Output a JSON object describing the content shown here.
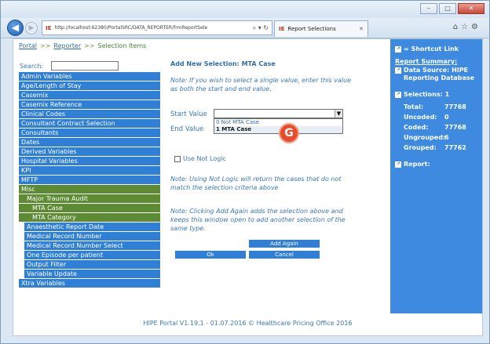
{
  "window": {
    "tab_label": "Report Selections",
    "address": "http://localhost:62380/PortalSRC/DATA_REPORTER/frmReportSele",
    "controls": [
      "–",
      "□",
      "✕"
    ],
    "favicon": "IE"
  },
  "breadcrumb": {
    "portal": "Portal",
    "reporter": "Reporter",
    "current": "Selection Items",
    "separator": ">>"
  },
  "search": {
    "label": "Search:",
    "value": ""
  },
  "menu": {
    "items": [
      {
        "label": "Admin Variables"
      },
      {
        "label": "Age/Length of Stay"
      },
      {
        "label": "Casemix"
      },
      {
        "label": "Casemix Reference"
      },
      {
        "label": "Clinical Codes"
      },
      {
        "label": "Consultant Contract Selection"
      },
      {
        "label": "Consultants"
      },
      {
        "label": "Dates"
      },
      {
        "label": "Derived Variables"
      },
      {
        "label": "Hospital Variables"
      },
      {
        "label": "KPI"
      },
      {
        "label": "MFTP"
      },
      {
        "label": "Misc"
      },
      {
        "label": "Major Trauma Audit"
      },
      {
        "label": "MTA Case"
      },
      {
        "label": "MTA Category"
      },
      {
        "label": "Anaesthetic Report Date"
      },
      {
        "label": "Medical Record Number"
      },
      {
        "label": "Medical Record Number Select"
      },
      {
        "label": "One Episode per patient"
      },
      {
        "label": "Output Filter"
      },
      {
        "label": "Variable Update"
      },
      {
        "label": "Xtra Variables"
      }
    ]
  },
  "form": {
    "title": "Add New Selection: MTA Case",
    "note_single": "Note: If you wish to select a single value, enter this value as both the start and end value.",
    "start_label": "Start Value",
    "end_label": "End Value",
    "start_value": "",
    "options": [
      "0 Not MTA Case",
      "1 MTA Case"
    ],
    "highlight_marker": "G",
    "use_not_logic_label": "Use Not Logic",
    "note_not_logic": "Note: Using Not Logic will return the cases that do not match the selection criteria above",
    "note_add_again": "Note: Clicking Add Again adds the selection above and keeps this window open to add another selection of the same type.",
    "add_again": "Add Again",
    "ok": "Ok",
    "cancel": "Cancel"
  },
  "right_panel": {
    "shortcut": "= Shortcut Link",
    "report_summary": "Report Summary:",
    "data_source_label": "Data Source: HIPE",
    "data_source_value": "Reporting Database",
    "selections": "Selections: 1",
    "stats": [
      {
        "label": "Total:",
        "value": "77768"
      },
      {
        "label": "Uncoded:",
        "value": "0"
      },
      {
        "label": "Coded:",
        "value": "77768"
      },
      {
        "label": "Ungrouped:",
        "value": "6"
      },
      {
        "label": "Grouped:",
        "value": "77762"
      }
    ],
    "report": "Report:"
  },
  "footer": "HIPE Portal V1.19.1 - 01.07.2016 © Healthcare Pricing Office 2016"
}
